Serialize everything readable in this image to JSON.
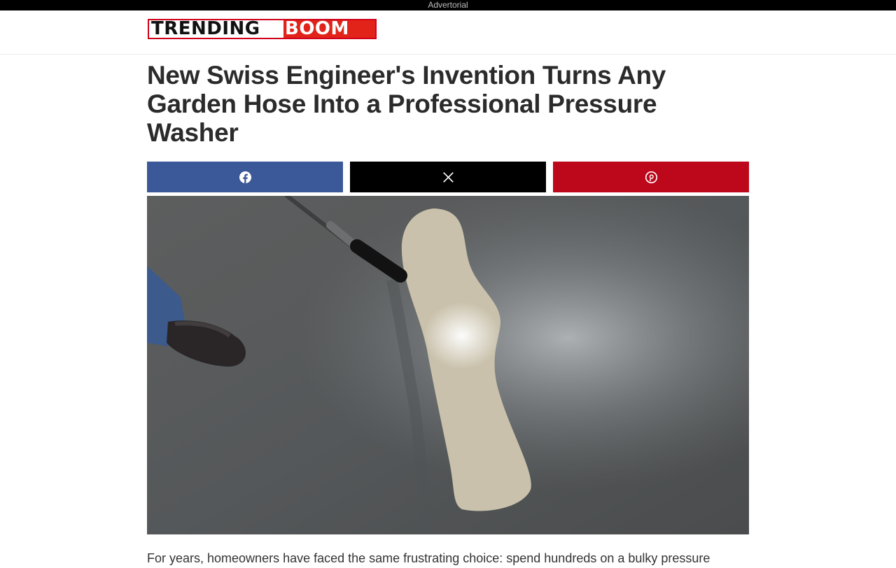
{
  "ad_label": "Advertorial",
  "logo": {
    "part1": "TRENDING",
    "part2": "BOOM",
    "colors": {
      "border": "#d0021b",
      "accent": "#e2231a"
    }
  },
  "article": {
    "headline": "New Swiss Engineer's Invention Turns Any Garden Hose Into a Professional Pressure Washer",
    "intro": "For years, homeowners have faced the same frustrating choice: spend hundreds on a bulky pressure"
  },
  "share": {
    "buttons": [
      {
        "network": "facebook",
        "icon": "facebook-icon",
        "color": "#3b5998"
      },
      {
        "network": "x",
        "icon": "x-icon",
        "color": "#000000"
      },
      {
        "network": "pinterest",
        "icon": "pinterest-icon",
        "color": "#bd081c"
      }
    ]
  },
  "hero_image": {
    "subject": "pressure washer nozzle cleaning a stripe on a concrete driveway"
  }
}
